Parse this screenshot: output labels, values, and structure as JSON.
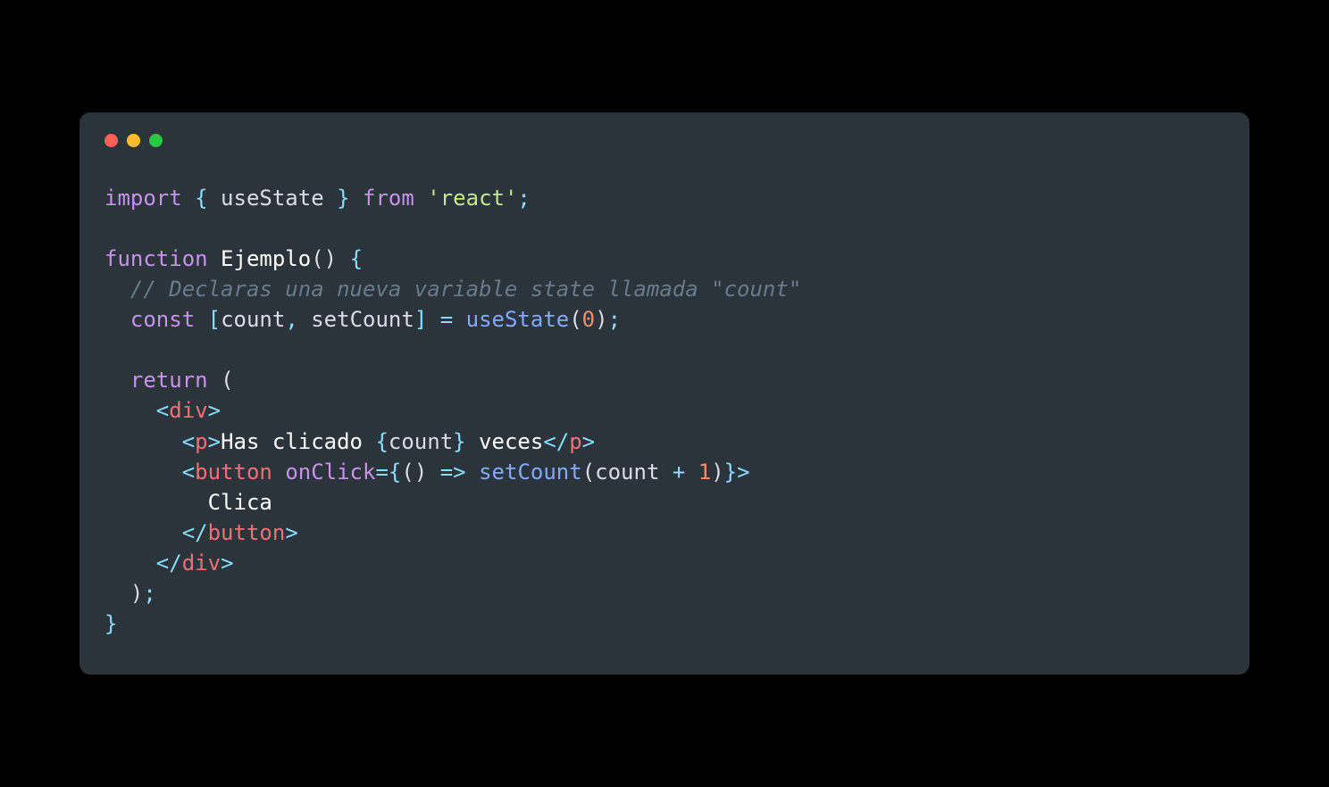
{
  "window": {
    "traffic_lights": [
      "red",
      "yellow",
      "green"
    ]
  },
  "code": {
    "tokens": [
      [
        [
          "import",
          "keyword"
        ],
        [
          " ",
          "default"
        ],
        [
          "{",
          "brace"
        ],
        [
          " useState ",
          "default"
        ],
        [
          "}",
          "brace"
        ],
        [
          " ",
          "default"
        ],
        [
          "from",
          "keyword"
        ],
        [
          " ",
          "default"
        ],
        [
          "'react'",
          "string"
        ],
        [
          ";",
          "punct"
        ]
      ],
      [],
      [
        [
          "function",
          "keyword"
        ],
        [
          " ",
          "default"
        ],
        [
          "Ejemplo",
          "white"
        ],
        [
          "()",
          "paren"
        ],
        [
          " ",
          "default"
        ],
        [
          "{",
          "brace"
        ]
      ],
      [
        [
          "  ",
          "default"
        ],
        [
          "// Declaras una nueva variable state llamada \"count\"",
          "comment"
        ]
      ],
      [
        [
          "  ",
          "default"
        ],
        [
          "const",
          "keyword"
        ],
        [
          " ",
          "default"
        ],
        [
          "[",
          "punct"
        ],
        [
          "count",
          "default"
        ],
        [
          ",",
          "punct"
        ],
        [
          " setCount",
          "default"
        ],
        [
          "]",
          "punct"
        ],
        [
          " ",
          "default"
        ],
        [
          "=",
          "punct"
        ],
        [
          " ",
          "default"
        ],
        [
          "useState",
          "func"
        ],
        [
          "(",
          "paren"
        ],
        [
          "0",
          "number"
        ],
        [
          ")",
          "paren"
        ],
        [
          ";",
          "punct"
        ]
      ],
      [],
      [
        [
          "  ",
          "default"
        ],
        [
          "return",
          "keyword"
        ],
        [
          " ",
          "default"
        ],
        [
          "(",
          "paren"
        ]
      ],
      [
        [
          "    ",
          "default"
        ],
        [
          "<",
          "tagbracket"
        ],
        [
          "div",
          "tag"
        ],
        [
          ">",
          "tagbracket"
        ]
      ],
      [
        [
          "      ",
          "default"
        ],
        [
          "<",
          "tagbracket"
        ],
        [
          "p",
          "tag"
        ],
        [
          ">",
          "tagbracket"
        ],
        [
          "Has clicado ",
          "white"
        ],
        [
          "{",
          "brace"
        ],
        [
          "count",
          "default"
        ],
        [
          "}",
          "brace"
        ],
        [
          " veces",
          "white"
        ],
        [
          "</",
          "tagbracket"
        ],
        [
          "p",
          "tag"
        ],
        [
          ">",
          "tagbracket"
        ]
      ],
      [
        [
          "      ",
          "default"
        ],
        [
          "<",
          "tagbracket"
        ],
        [
          "button",
          "tag"
        ],
        [
          " ",
          "default"
        ],
        [
          "onClick",
          "attr"
        ],
        [
          "=",
          "punct"
        ],
        [
          "{",
          "brace"
        ],
        [
          "()",
          "paren"
        ],
        [
          " ",
          "default"
        ],
        [
          "=>",
          "punct"
        ],
        [
          " ",
          "default"
        ],
        [
          "setCount",
          "func"
        ],
        [
          "(",
          "paren"
        ],
        [
          "count ",
          "default"
        ],
        [
          "+",
          "punct"
        ],
        [
          " ",
          "default"
        ],
        [
          "1",
          "number"
        ],
        [
          ")",
          "paren"
        ],
        [
          "}",
          "brace"
        ],
        [
          ">",
          "tagbracket"
        ]
      ],
      [
        [
          "        Clica",
          "white"
        ]
      ],
      [
        [
          "      ",
          "default"
        ],
        [
          "</",
          "tagbracket"
        ],
        [
          "button",
          "tag"
        ],
        [
          ">",
          "tagbracket"
        ]
      ],
      [
        [
          "    ",
          "default"
        ],
        [
          "</",
          "tagbracket"
        ],
        [
          "div",
          "tag"
        ],
        [
          ">",
          "tagbracket"
        ]
      ],
      [
        [
          "  ",
          "default"
        ],
        [
          ")",
          "paren"
        ],
        [
          ";",
          "punct"
        ]
      ],
      [
        [
          "}",
          "brace"
        ]
      ]
    ]
  }
}
